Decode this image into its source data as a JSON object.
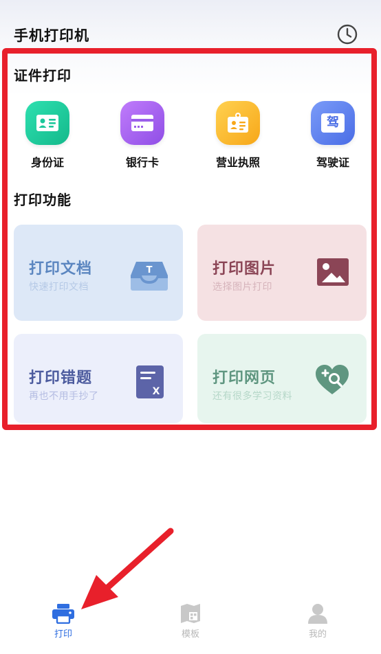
{
  "header": {
    "app_title": "手机打印机",
    "history_icon": "clock-history-icon"
  },
  "certificates": {
    "title": "证件打印",
    "items": [
      {
        "label": "身份证",
        "icon": "id-card-icon",
        "color": "#1bc79a"
      },
      {
        "label": "银行卡",
        "icon": "bank-card-icon",
        "color": "#a564ef"
      },
      {
        "label": "营业执照",
        "icon": "business-license-icon",
        "color": "#fbbd2a"
      },
      {
        "label": "驾驶证",
        "icon": "driver-license-icon",
        "glyph": "驾",
        "color": "#5b7ff0"
      }
    ]
  },
  "functions": {
    "title": "打印功能",
    "cards": [
      {
        "title": "打印文档",
        "subtitle": "快速打印文档",
        "icon": "document-tray-icon"
      },
      {
        "title": "打印图片",
        "subtitle": "选择图片打印",
        "icon": "image-icon"
      },
      {
        "title": "打印错题",
        "subtitle": "再也不用手抄了",
        "icon": "wrong-question-icon"
      },
      {
        "title": "打印网页",
        "subtitle": "还有很多学习资料",
        "icon": "web-search-icon"
      }
    ]
  },
  "doc_icon_glyph": "T",
  "err_icon_glyph": "X",
  "tab_bar": {
    "items": [
      {
        "label": "打印",
        "icon": "printer-icon",
        "active": true
      },
      {
        "label": "模板",
        "icon": "template-icon",
        "active": false
      },
      {
        "label": "我的",
        "icon": "profile-icon",
        "active": false
      }
    ]
  },
  "colors": {
    "accent": "#2f6ee0",
    "highlight_frame": "#e8202b",
    "annotation_arrow": "#e8202b"
  }
}
